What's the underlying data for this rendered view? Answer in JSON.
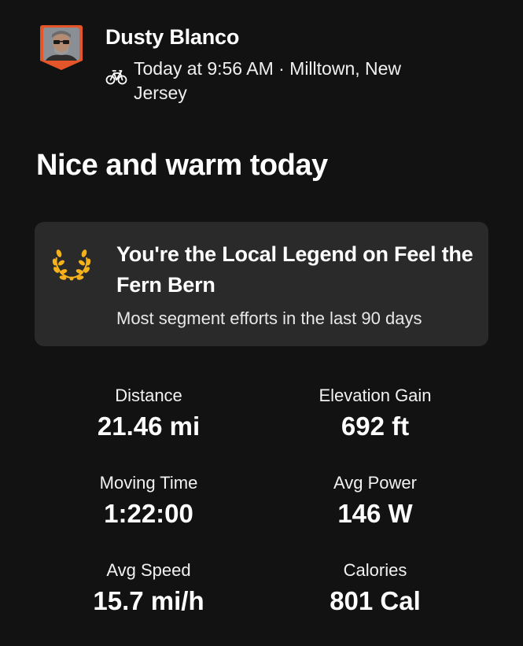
{
  "athlete": {
    "name": "Dusty Blanco"
  },
  "activity": {
    "sport_icon": "bike-icon",
    "meta": "Today at 9:56 AM · Milltown, New Jersey",
    "title": "Nice and warm today"
  },
  "legend": {
    "icon": "laurel-icon",
    "title": "You're the Local Legend on Feel the Fern Bern",
    "subtitle": "Most segment efforts in the last 90 days",
    "accent_color": "#f6b21a"
  },
  "stats": [
    {
      "label": "Distance",
      "value": "21.46 mi"
    },
    {
      "label": "Elevation Gain",
      "value": "692 ft"
    },
    {
      "label": "Moving Time",
      "value": "1:22:00"
    },
    {
      "label": "Avg Power",
      "value": "146 W"
    },
    {
      "label": "Avg Speed",
      "value": "15.7 mi/h"
    },
    {
      "label": "Calories",
      "value": "801 Cal"
    }
  ]
}
